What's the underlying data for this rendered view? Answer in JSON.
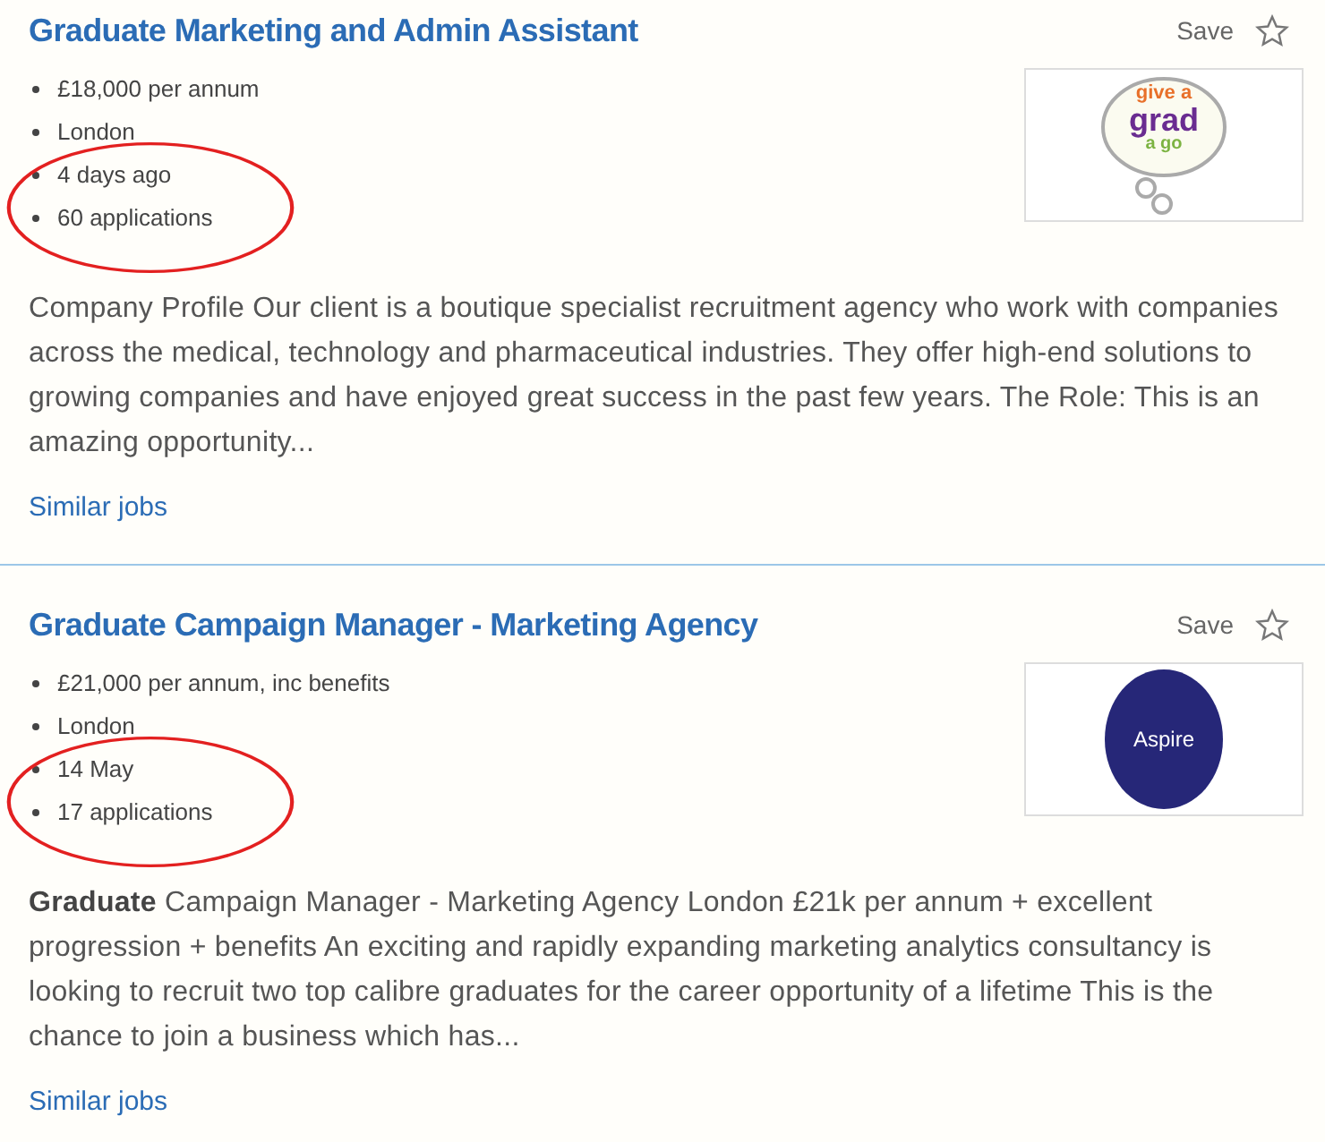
{
  "jobs": [
    {
      "title": "Graduate Marketing and Admin Assistant",
      "save": "Save",
      "saved": false,
      "details": [
        "£18,000 per annum",
        "London",
        "4 days ago",
        "60 applications"
      ],
      "circled": true,
      "logo": {
        "kind": "bubble",
        "lines": [
          "give a",
          "grad",
          "a go"
        ]
      },
      "description": "Company Profile Our client is a boutique specialist recruitment agency who work with companies across the medical, technology and pharmaceutical industries. They offer high-end solutions to growing companies and have enjoyed great success in the past few years. The Role: This is an amazing opportunity...",
      "link": "Similar jobs"
    },
    {
      "title": "Graduate Campaign Manager - Marketing Agency",
      "save": "Save",
      "saved": false,
      "details": [
        "£21,000 per annum, inc benefits",
        "London",
        "14 May",
        "17 applications"
      ],
      "circled": true,
      "logo": {
        "kind": "circle",
        "lines": [
          "Aspire"
        ]
      },
      "description": "**Graduate** Campaign Manager - Marketing Agency London £21k per annum + excellent progression + benefits An exciting and rapidly expanding marketing analytics consultancy is looking to recruit two top calibre graduates for the career opportunity of a lifetime This is the chance to join a business which has...",
      "link": "Similar jobs"
    }
  ]
}
